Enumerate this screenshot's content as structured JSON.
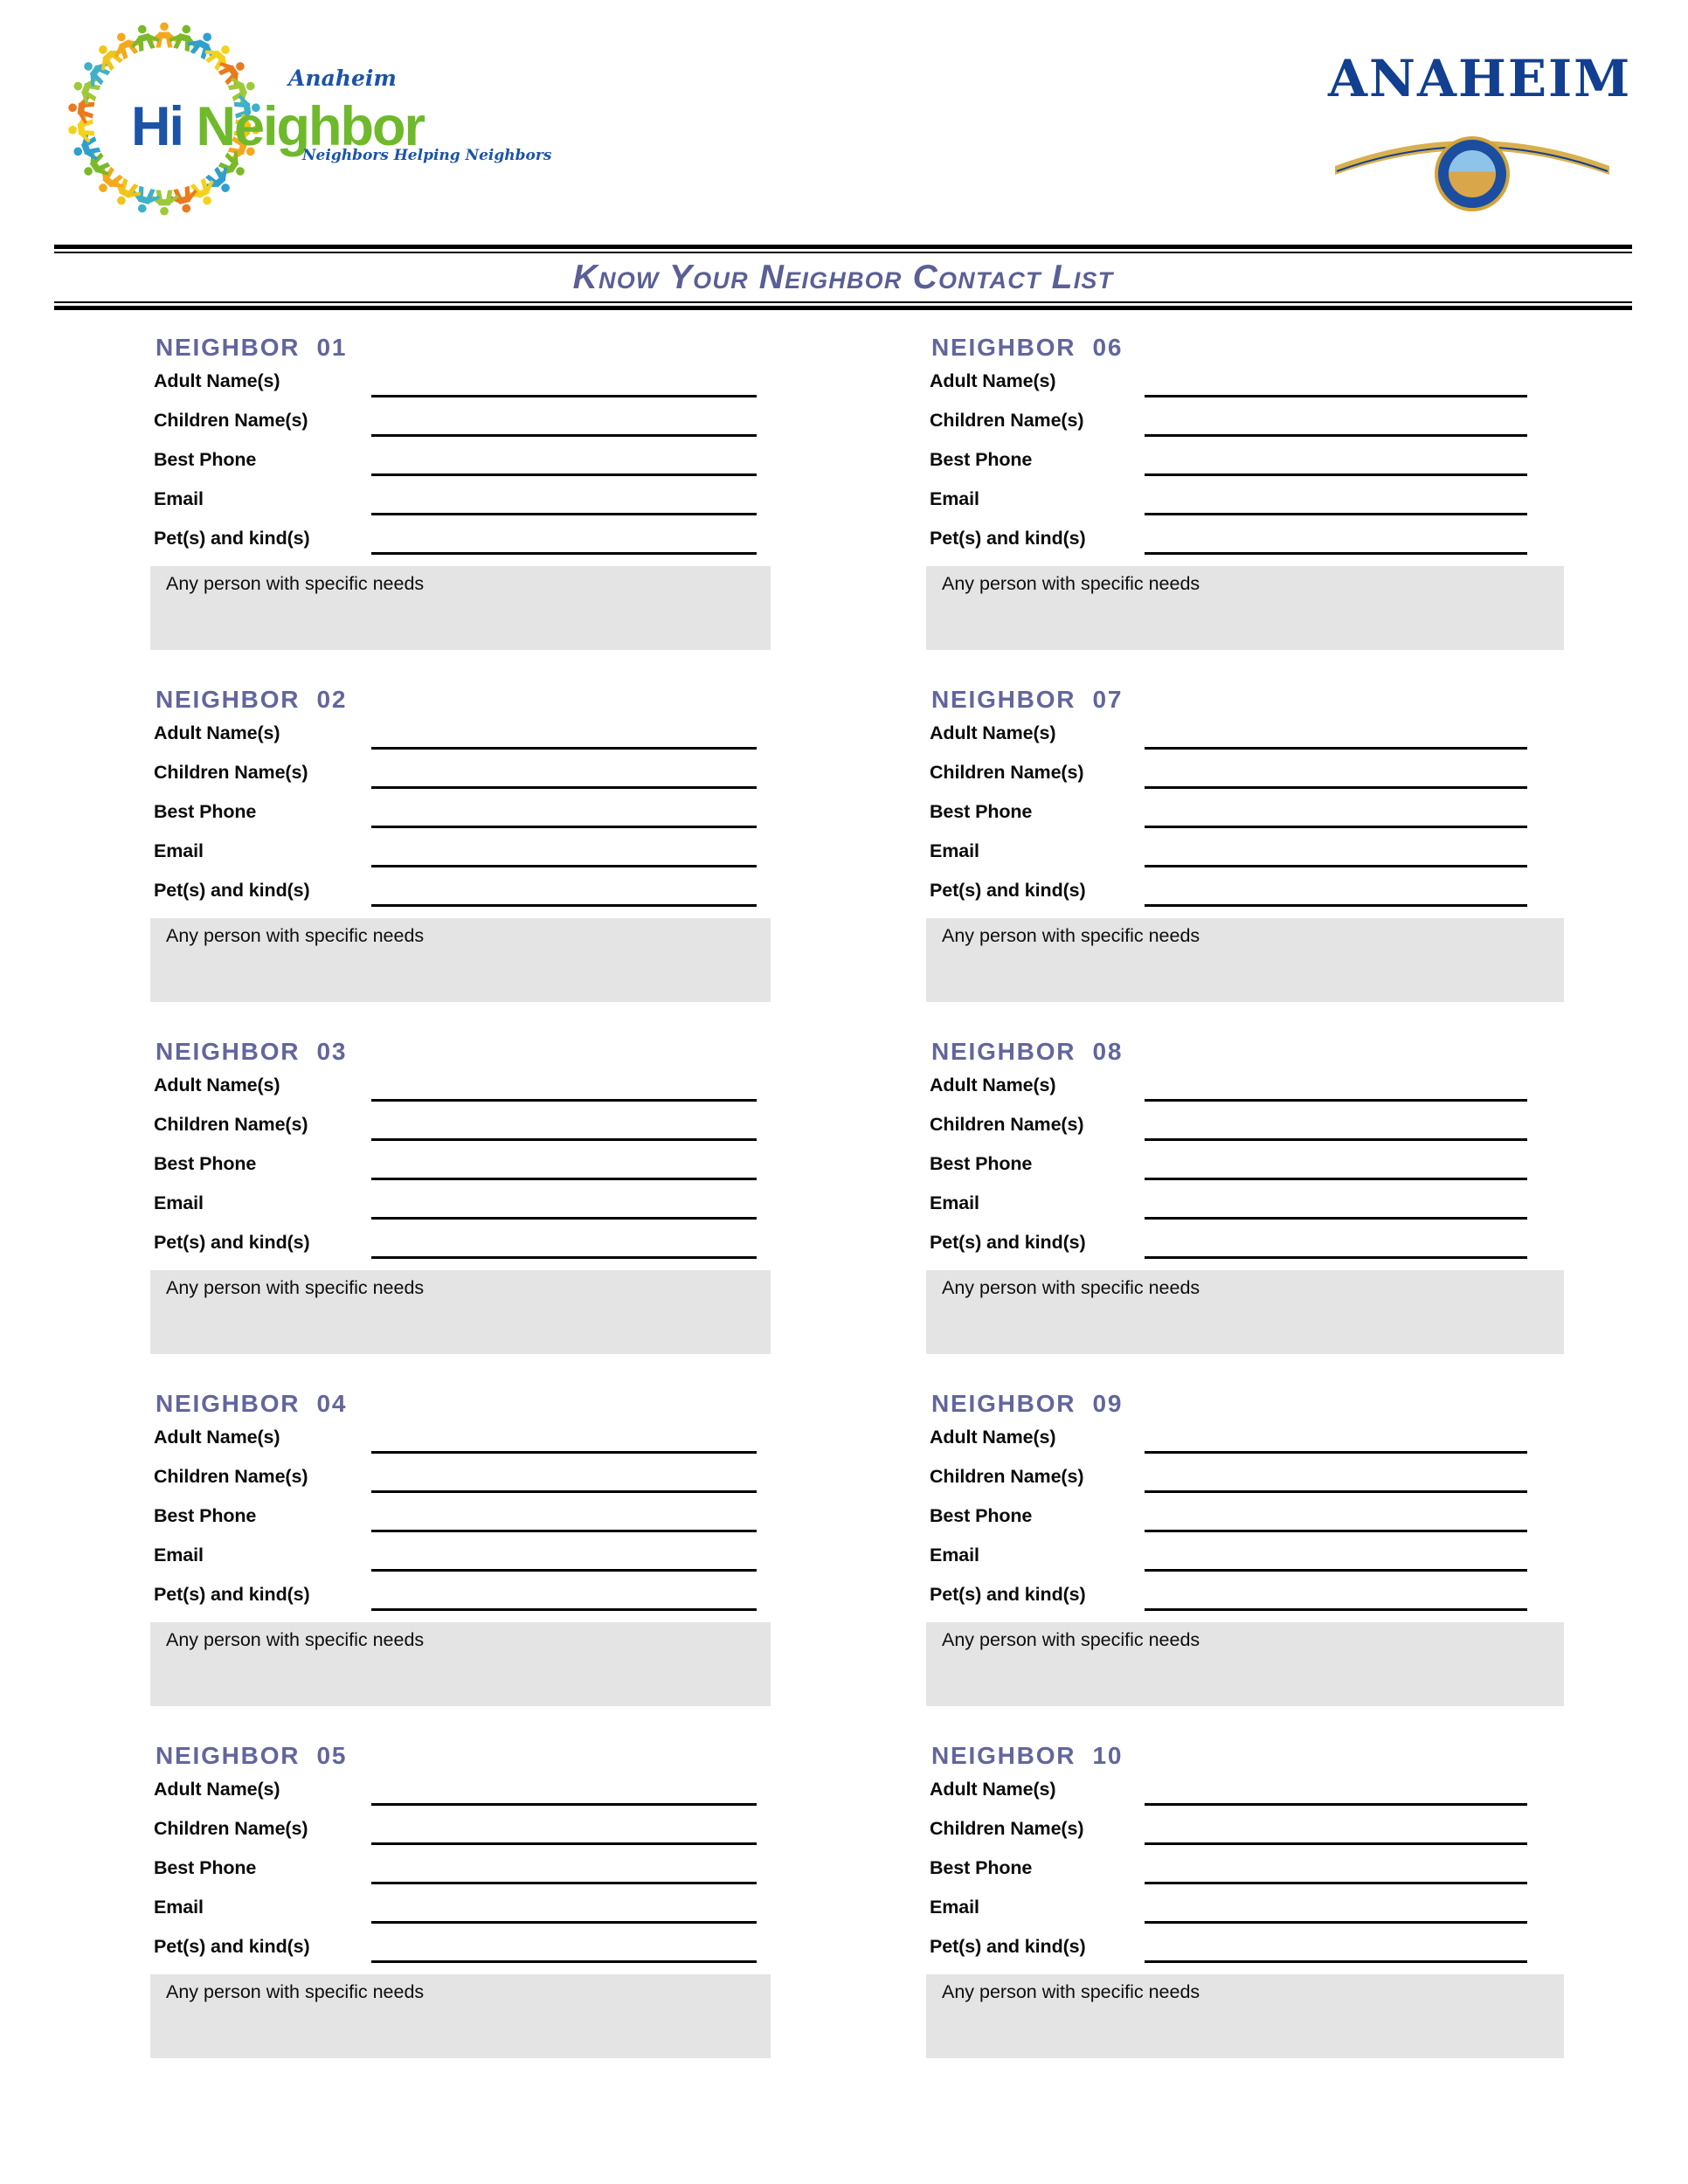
{
  "header": {
    "hi_neighbor_logo": {
      "icon": "people-circle-logo",
      "anaheim_script": "Anaheim",
      "word_hi": "Hi",
      "word_neighbor": "Neighbor",
      "tagline": "Neighbors Helping Neighbors"
    },
    "anaheim_logo": {
      "icon": "anaheim-city-seal",
      "arch_text": "ANAHEIM"
    }
  },
  "title": "Know Your Neighbor Contact List",
  "field_labels": {
    "adult_names": "Adult Name(s)",
    "children_names": "Children Name(s)",
    "best_phone": "Best Phone",
    "email": "Email",
    "pets": "Pet(s) and kind(s)",
    "special_needs": "Any person with specific needs"
  },
  "colors": {
    "title": "#5b5f96",
    "block_heading": "#62669c",
    "needs_box": "#e4e4e4",
    "rule": "#000000"
  },
  "columns": [
    {
      "side": "left",
      "blocks": [
        {
          "heading": "NEIGHBOR  01"
        },
        {
          "heading": "NEIGHBOR  02"
        },
        {
          "heading": "NEIGHBOR  03"
        },
        {
          "heading": "NEIGHBOR  04"
        },
        {
          "heading": "NEIGHBOR  05"
        }
      ]
    },
    {
      "side": "right",
      "blocks": [
        {
          "heading": "NEIGHBOR  06"
        },
        {
          "heading": "NEIGHBOR  07"
        },
        {
          "heading": "NEIGHBOR  08"
        },
        {
          "heading": "NEIGHBOR  09"
        },
        {
          "heading": "NEIGHBOR  10"
        }
      ]
    }
  ]
}
